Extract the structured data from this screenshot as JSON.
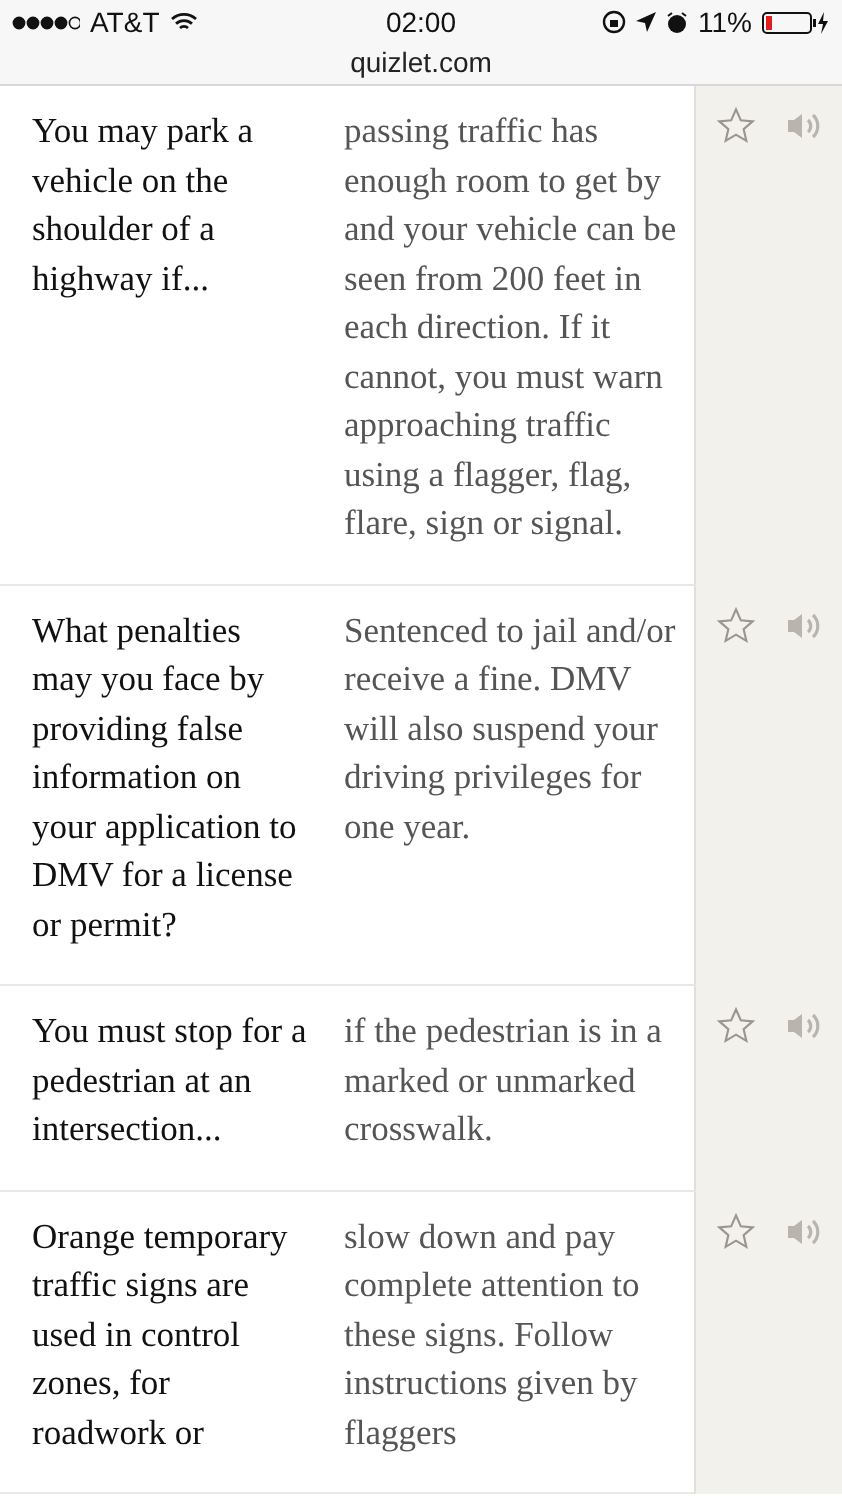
{
  "status_bar": {
    "carrier": "AT&T",
    "time": "02:00",
    "battery": "11%"
  },
  "address_bar": {
    "url": "quizlet.com"
  },
  "cards": [
    {
      "term": "You may park a vehicle on the shoulder of a highway if...",
      "definition": "passing traffic has enough room to get by and your vehicle can be seen from 200 feet in each direction. If it cannot, you must warn approaching traffic using a flagger, flag, flare, sign or signal.",
      "starred": false
    },
    {
      "term": "What penalties may you face by providing false information on your application to DMV for a license or permit?",
      "definition": "Sentenced to jail and/or receive a fine. DMV will also suspend your driving privileges for one year.",
      "starred": false
    },
    {
      "term": "You must stop for a pedestrian at an intersection...",
      "definition": "if the pedestrian is in a marked or unmarked crosswalk.",
      "starred": false
    },
    {
      "term": "Orange temporary traffic signs are used in control zones, for roadwork or",
      "definition": "slow down and pay complete attention to these signs. Follow instructions given by flaggers",
      "starred": false
    }
  ]
}
